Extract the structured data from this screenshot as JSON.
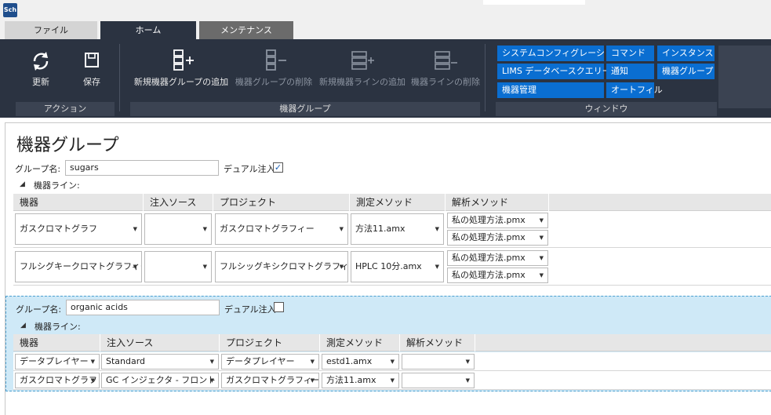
{
  "app": {
    "icon_text": "Sch"
  },
  "tabs": [
    {
      "label": "ファイル"
    },
    {
      "label": "ホーム"
    },
    {
      "label": "メンテナンス"
    }
  ],
  "ribbon": {
    "actions": {
      "refresh": "更新",
      "save": "保存",
      "group_label": "アクション"
    },
    "instrument_group": {
      "add_group": "新規機器グループの追加",
      "delete_group": "機器グループの削除",
      "add_line": "新規機器ラインの追加",
      "delete_line": "機器ラインの削除",
      "group_label": "機器グループ"
    },
    "window": {
      "system_config": "システムコンフィグレーション",
      "command": "コマンド",
      "instance": "インスタンス",
      "lims_query": "LIMS データベースクエリー",
      "notify": "通知",
      "instrument_group": "機器グループ",
      "instrument_mgmt": "機器管理",
      "autofill": "オートフィル",
      "group_label": "ウィンドウ"
    }
  },
  "page": {
    "title": "機器グループ"
  },
  "groups": [
    {
      "name_label": "グループ名:",
      "name_value": "sugars",
      "dual_label": "デュアル注入",
      "dual_checked": "✓",
      "lines_label": "機器ライン:",
      "headers": [
        "機器",
        "注入ソース",
        "プロジェクト",
        "測定メソッド",
        "解析メソッド"
      ],
      "rows": [
        {
          "instrument": "ガスクロマトグラフ",
          "source": "",
          "project": "ガスクロマトグラフィー",
          "method": "方法11.amx",
          "processing": [
            "私の処理方法.pmx",
            "私の処理方法.pmx"
          ]
        },
        {
          "instrument": "フルシグキークロマトグラフィー",
          "source": "",
          "project": "フルシッグキシクロマトグラフィー",
          "method": "HPLC 10分.amx",
          "processing": [
            "私の処理方法.pmx",
            "私の処理方法.pmx"
          ]
        }
      ]
    },
    {
      "name_label": "グループ名:",
      "name_value": "organic acids",
      "dual_label": "デュアル注入",
      "dual_checked": "",
      "lines_label": "機器ライン:",
      "headers": [
        "機器",
        "注入ソース",
        "プロジェクト",
        "測定メソッド",
        "解析メソッド"
      ],
      "rows": [
        {
          "instrument": "データプレイヤー",
          "source": "Standard",
          "project": "データプレイヤー",
          "method": "estd1.amx",
          "processing": [
            ""
          ]
        },
        {
          "instrument": "ガスクロマトグラフ",
          "source": "GC インジェクタ - フロント",
          "project": "ガスクロマトグラフィー",
          "method": "方法11.amx",
          "processing": [
            ""
          ]
        }
      ]
    }
  ],
  "colors": {
    "ribbon_bg": "#2b3341",
    "window_button": "#0a6ed1",
    "selected_group": "#cfe9f7"
  }
}
